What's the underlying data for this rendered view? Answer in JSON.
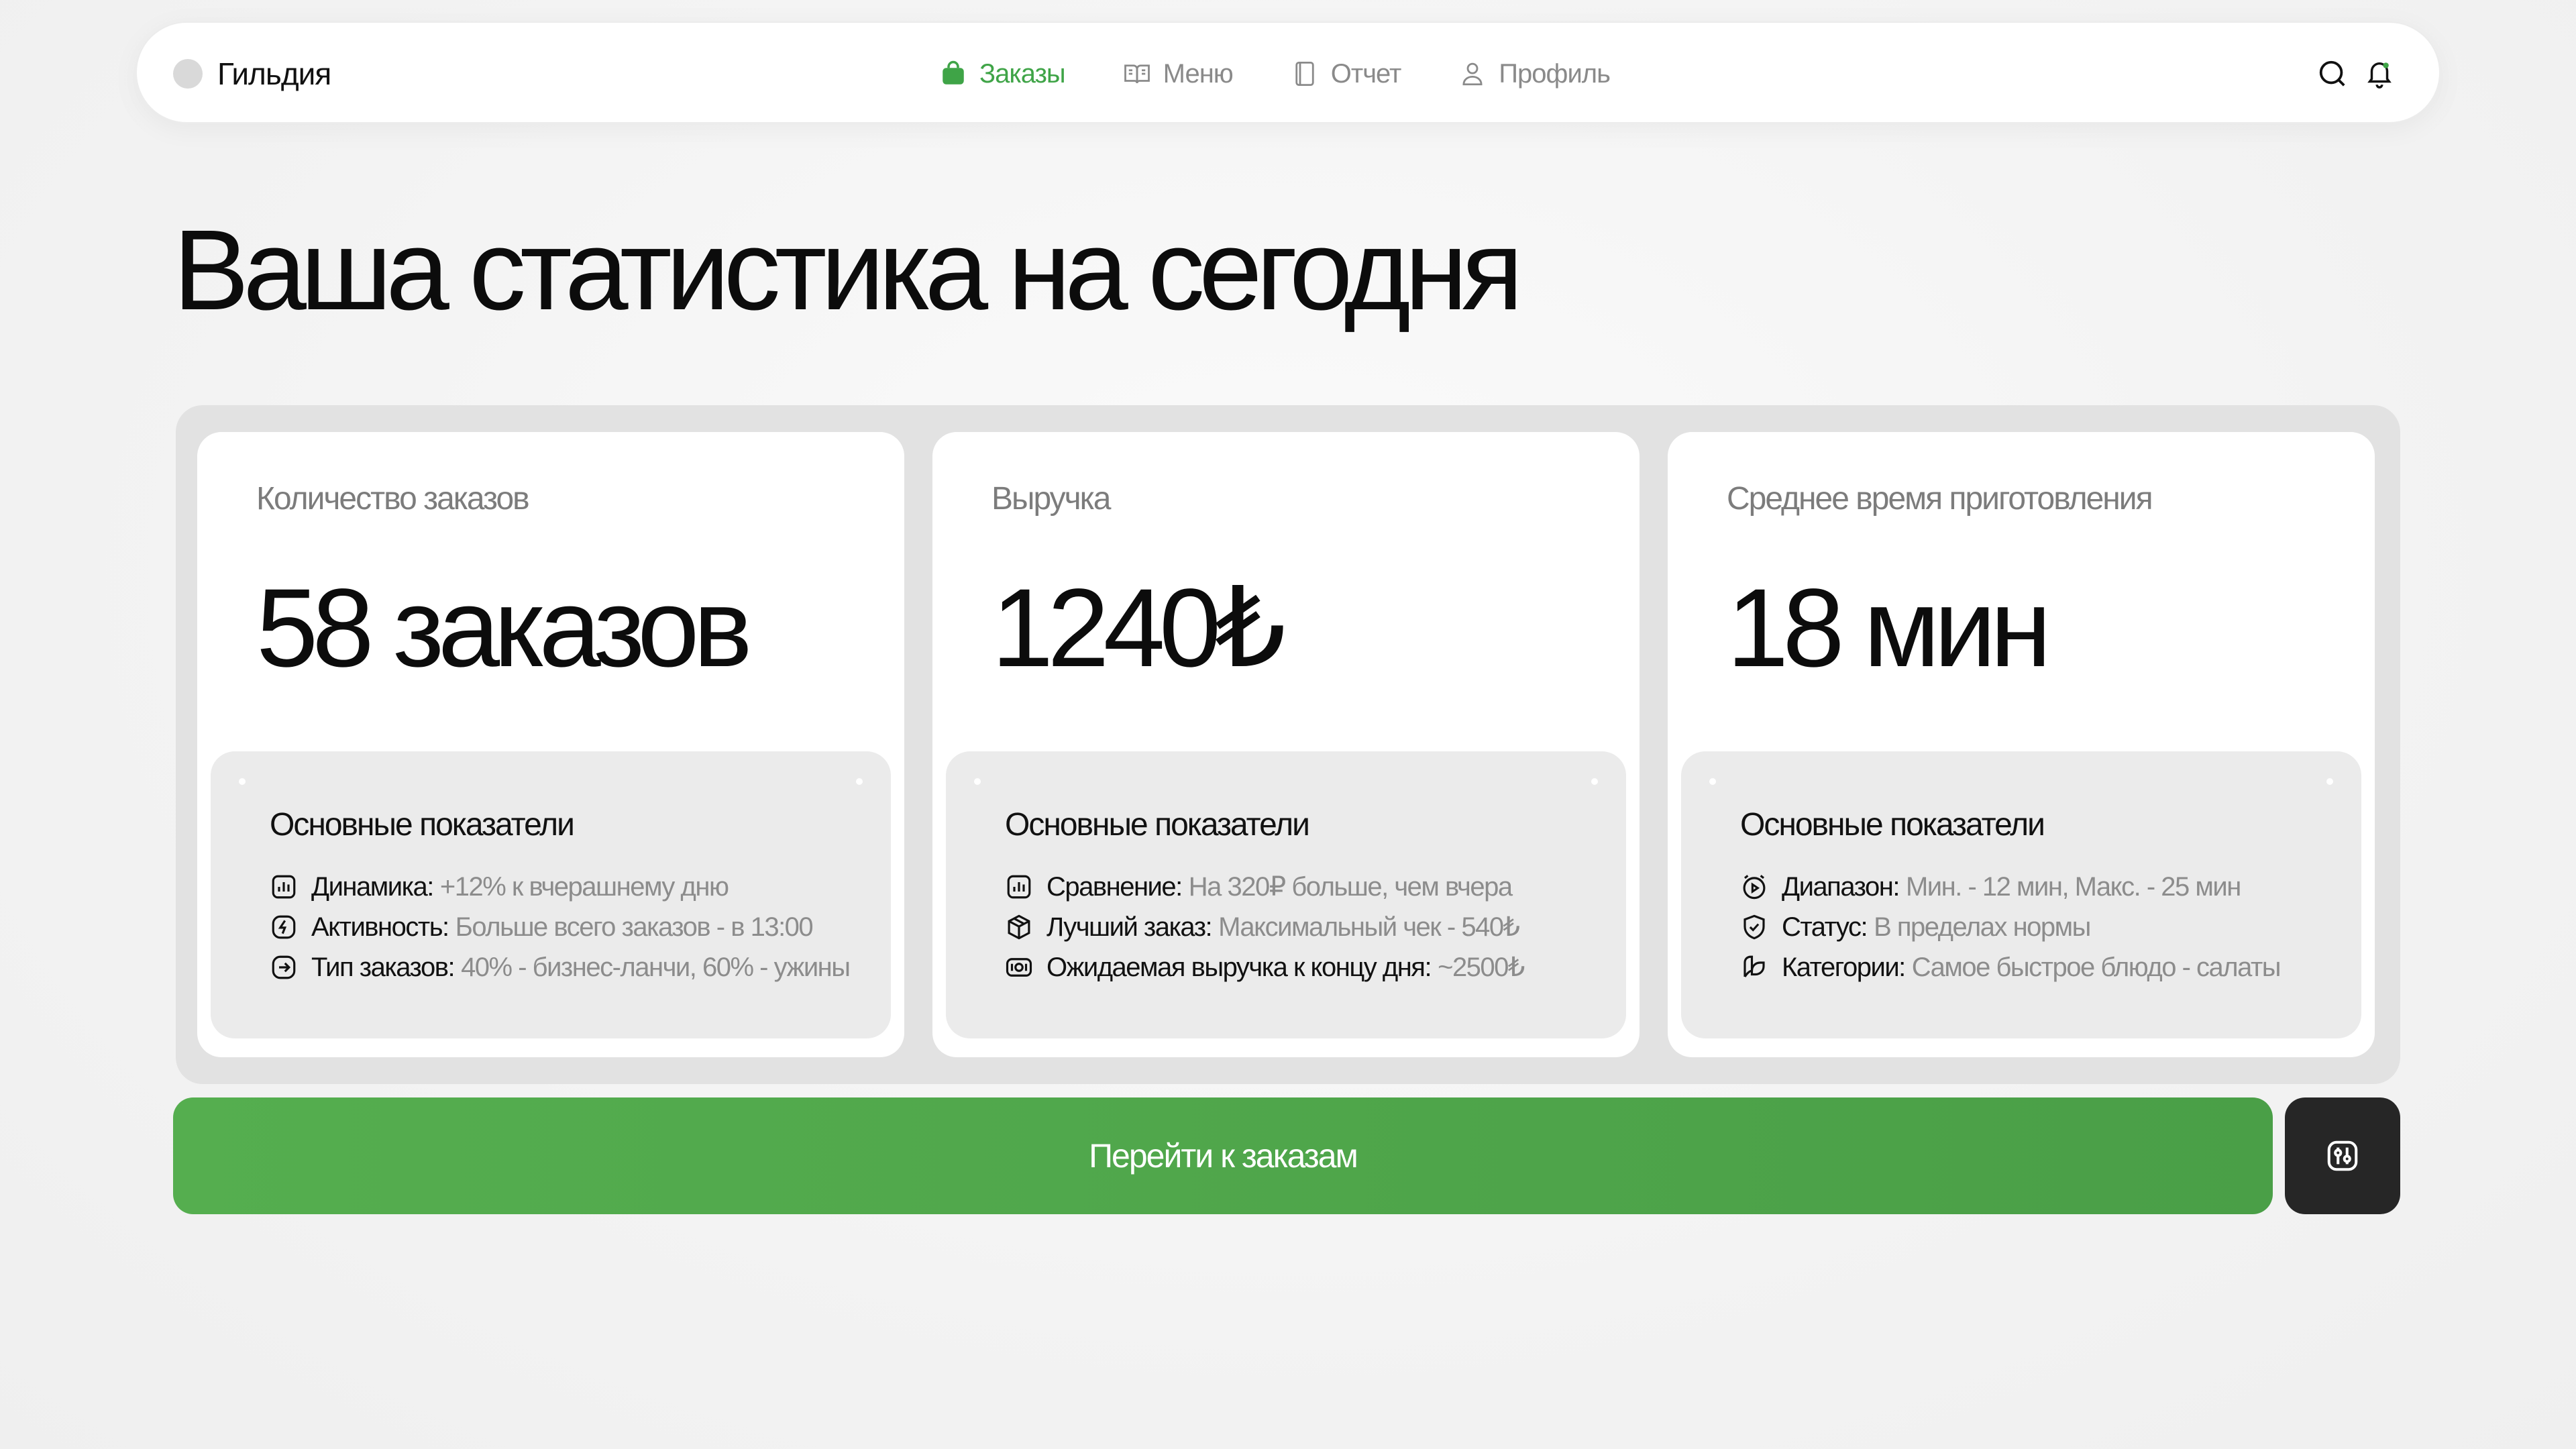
{
  "colors": {
    "accent": "#4caa4a",
    "dark_button": "#262626",
    "panel": "#e2e2e2"
  },
  "nav": {
    "brand": "Гильдия",
    "links": [
      {
        "label": "Заказы",
        "icon": "shopping-bag-icon",
        "active": true
      },
      {
        "label": "Меню",
        "icon": "book-open-icon",
        "active": false
      },
      {
        "label": "Отчет",
        "icon": "book-icon",
        "active": false
      },
      {
        "label": "Профиль",
        "icon": "user-icon",
        "active": false
      }
    ],
    "actions": [
      "search-icon",
      "bell-icon"
    ]
  },
  "page": {
    "title": "Ваша статистика на сегодня"
  },
  "cards": [
    {
      "label": "Количество заказов",
      "value": "58 заказов",
      "section_title": "Основные показатели",
      "rows": [
        {
          "icon": "bar-chart-icon",
          "key": "Динамика:",
          "value": "+12% к вчерашнему дню"
        },
        {
          "icon": "lightning-icon",
          "key": "Активность:",
          "value": "Больше всего заказов - в 13:00"
        },
        {
          "icon": "arrow-right-square-icon",
          "key": "Тип заказов:",
          "value": "40% - бизнес-ланчи, 60% - ужины"
        }
      ]
    },
    {
      "label": "Выручка",
      "value": "1240₺",
      "section_title": "Основные показатели",
      "rows": [
        {
          "icon": "bar-chart-icon",
          "key": "Сравнение:",
          "value": "На 320₽ больше, чем вчера"
        },
        {
          "icon": "box-icon",
          "key": "Лучший заказ:",
          "value": "Максимальный чек - 540₺"
        },
        {
          "icon": "money-icon",
          "key": "Ожидаемая выручка к концу дня:",
          "value": "~2500₺"
        }
      ]
    },
    {
      "label": "Среднее время приготовления",
      "value": "18 мин",
      "section_title": "Основные показатели",
      "rows": [
        {
          "icon": "timer-icon",
          "key": "Диапазон:",
          "value": "Мин. - 12 мин, Макс. - 25 мин"
        },
        {
          "icon": "shield-check-icon",
          "key": "Статус:",
          "value": "В пределах нормы"
        },
        {
          "icon": "leaf-icon",
          "key": "Категории:",
          "value": "Самое быстрое блюдо - салаты"
        }
      ]
    }
  ],
  "actions": {
    "primary_label": "Перейти к заказам",
    "secondary_icon": "sliders-icon"
  }
}
